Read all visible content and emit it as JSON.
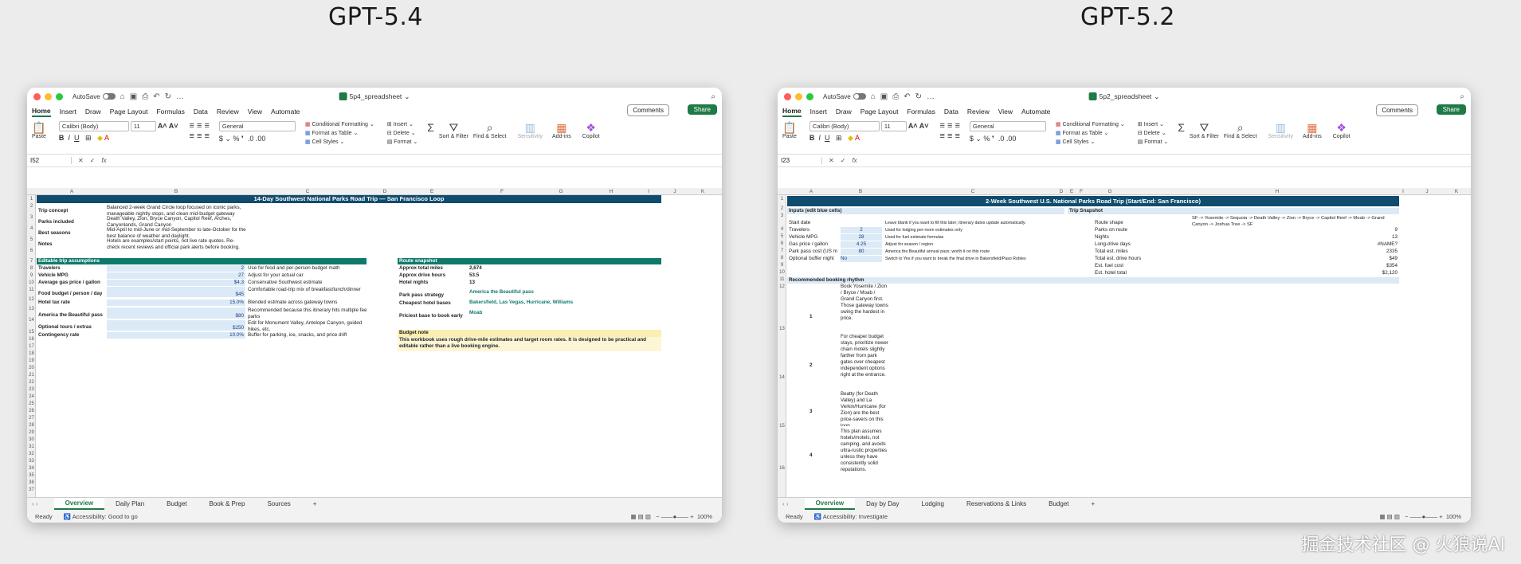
{
  "captions": {
    "left": "GPT-5.4",
    "right": "GPT-5.2"
  },
  "watermark": "掘金技术社区 @ 火狼说AI",
  "left": {
    "autosave": "AutoSave",
    "file": "5p4_spreadsheet",
    "menu": [
      "Home",
      "Insert",
      "Draw",
      "Page Layout",
      "Formulas",
      "Data",
      "Review",
      "View",
      "Automate"
    ],
    "comments": "Comments",
    "share": "Share",
    "ribbon": {
      "paste": "Paste",
      "font": "Calibri (Body)",
      "size": "11",
      "number": "General",
      "cond": "Conditional Formatting",
      "table": "Format as Table",
      "styles": "Cell Styles",
      "insert": "Insert",
      "delete": "Delete",
      "format": "Format",
      "sort": "Sort & Filter",
      "find": "Find & Select",
      "sens": "Sensitivity",
      "addins": "Add-ins",
      "copilot": "Copilot"
    },
    "namebox": "I52",
    "cols": [
      "A",
      "B",
      "C",
      "D",
      "E",
      "F",
      "G",
      "H",
      "I",
      "J",
      "K"
    ],
    "title": "14-Day Southwest National Parks Road Trip — San Francisco Loop",
    "info": [
      {
        "label": "Trip concept",
        "value": "Balanced 2-week Grand Circle loop focused on iconic parks, manageable nightly stops, and clean mid-budget gateway"
      },
      {
        "label": "Parks included",
        "value": "Death Valley, Zion, Bryce Canyon, Capitol Reef, Arches, Canyonlands, Grand Canyon"
      },
      {
        "label": "Best seasons",
        "value": "Mid-April to mid-June or mid-September to late-October for the best balance of weather and daylight."
      },
      {
        "label": "Notes",
        "value": "Hotels are examples/start points, not live rate quotes. Re-check recent reviews and official park alerts before booking."
      }
    ],
    "assump_title": "Editable trip assumptions",
    "assump": [
      {
        "label": "Travelers",
        "value": "2",
        "note": "Use for food and per-person budget math"
      },
      {
        "label": "Vehicle MPG",
        "value": "27",
        "note": "Adjust for your actual car"
      },
      {
        "label": "Average gas price / gallon",
        "value": "$4.3",
        "note": "Conservative Southwest estimate"
      },
      {
        "label": "Food budget / person / day",
        "value": "$45",
        "note": "Comfortable road-trip mix of breakfast/lunch/dinner"
      },
      {
        "label": "Hotel tax rate",
        "value": "15.0%",
        "note": "Blended estimate across gateway towns"
      },
      {
        "label": "America the Beautiful pass",
        "value": "$80",
        "note": "Recommended because this itinerary hits multiple fee parks"
      },
      {
        "label": "Optional tours / extras",
        "value": "$250",
        "note": "Edit for Monument Valley, Antelope Canyon, guided hikes, etc."
      },
      {
        "label": "Contingency rate",
        "value": "10.0%",
        "note": "Buffer for parking, ice, snacks, and price drift"
      }
    ],
    "route_title": "Route snapshot",
    "route": [
      {
        "label": "Approx total miles",
        "value": "2,674"
      },
      {
        "label": "Approx drive hours",
        "value": "53.5"
      },
      {
        "label": "Hotel nights",
        "value": "13"
      },
      {
        "label": "Park pass strategy",
        "value": "America the Beautiful pass"
      },
      {
        "label": "Cheapest hotel bases",
        "value": "Bakersfield, Las Vegas, Hurricane, Williams"
      },
      {
        "label": "Priciest base to book early",
        "value": "Moab"
      }
    ],
    "budget_title": "Budget note",
    "budget_text": "This workbook uses rough drive-mile estimates and target room rates. It is designed to be practical and editable rather than a live booking engine.",
    "tabs": [
      "Overview",
      "Daily Plan",
      "Budget",
      "Book & Prep",
      "Sources"
    ],
    "status": "Ready",
    "access": "Accessibility: Good to go",
    "zoom": "100%"
  },
  "right": {
    "autosave": "AutoSave",
    "file": "5p2_spreadsheet",
    "menu": [
      "Home",
      "Insert",
      "Draw",
      "Page Layout",
      "Formulas",
      "Data",
      "Review",
      "View",
      "Automate"
    ],
    "comments": "Comments",
    "share": "Share",
    "namebox": "I23",
    "cols": [
      "A",
      "B",
      "C",
      "D",
      "E",
      "F",
      "G",
      "H",
      "I",
      "J",
      "K"
    ],
    "title": "2-Week Southwest U.S. National Parks Road Trip (Start/End: San Francisco)",
    "inputs_title": "Inputs (edit blue cells)",
    "inputs": [
      {
        "label": "Start date",
        "value": "",
        "note": "Leave blank if you want to fill this later; itinerary dates update automatically."
      },
      {
        "label": "Travelers",
        "value": "2",
        "note": "Used for lodging per-room estimates only"
      },
      {
        "label": "Vehicle MPG",
        "value": "28",
        "note": "Used for fuel estimate formulas"
      },
      {
        "label": "Gas price / gallon",
        "value": "4.25",
        "note": "Adjust for season / region"
      },
      {
        "label": "Park pass cost (US m",
        "value": "80",
        "note": "America the Beautiful annual pass; worth it on this route"
      },
      {
        "label": "Optional buffer night",
        "value": "No",
        "note": "Switch to Yes if you want to break the final drive in Bakersfield/Paso Robles"
      }
    ],
    "snap_title": "Trip Snapshot",
    "snap": [
      {
        "label": "Route shape",
        "value": "SF -> Yosemite -> Sequoia -> Death Valley -> Zion -> Bryce -> Capitol Reef -> Moab -> Grand Canyon -> Joshua Tree -> SF"
      },
      {
        "label": "Parks on route",
        "value": "9"
      },
      {
        "label": "Nights",
        "value": "13"
      },
      {
        "label": "Long-drive days",
        "value": "#NAME?"
      },
      {
        "label": "Total est. miles",
        "value": "2335"
      },
      {
        "label": "Total est. drive hours",
        "value": "$49"
      },
      {
        "label": "Est. fuel cost",
        "value": "$354"
      },
      {
        "label": "Est. hotel total",
        "value": "$2,120"
      }
    ],
    "rhythm_title": "Recommended booking rhythm",
    "rhythm": [
      {
        "n": "1",
        "text": "Book Yosemite / Zion / Bryce / Moab / Grand Canyon first. Those gateway towns swing the hardest in price."
      },
      {
        "n": "2",
        "text": "For cheaper budget stays, prioritize newer chain motels slightly farther from park gates over cheapest independent options right at the entrance."
      },
      {
        "n": "3",
        "text": "Beatty (for Death Valley) and La Verkin/Hurricane (for Zion) are the best price-savers on this loop."
      },
      {
        "n": "4",
        "text": "This plan assumes hotels/motels, not camping, and avoids ultra-rustic properties unless they have consistently solid reputations."
      }
    ],
    "tabs": [
      "Overview",
      "Day by Day",
      "Lodging",
      "Reservations & Links",
      "Budget"
    ],
    "status": "Ready",
    "access": "Accessibility: Investigate",
    "zoom": "100%"
  }
}
